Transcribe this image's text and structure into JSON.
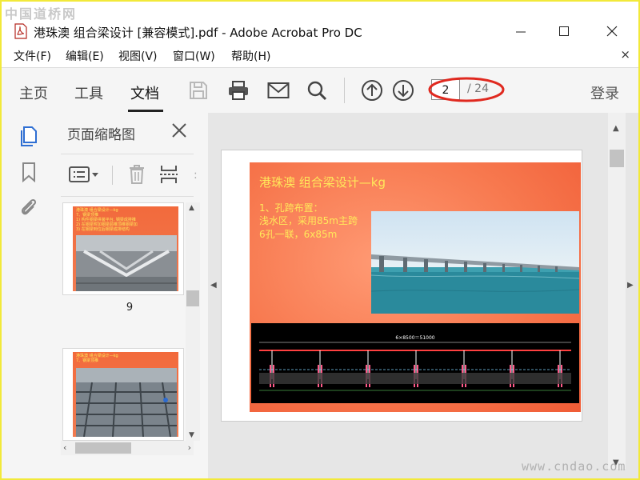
{
  "watermark_top": "中国道桥网",
  "watermark_bottom": "www.cndao.com",
  "window": {
    "title": "港珠澳 组合梁设计 [兼容模式].pdf - Adobe Acrobat Pro DC",
    "icon": "pdf-file-icon"
  },
  "menu": {
    "items": [
      "文件(F)",
      "编辑(E)",
      "视图(V)",
      "窗口(W)",
      "帮助(H)"
    ],
    "close_label": "×"
  },
  "toolbar": {
    "tabs": [
      "主页",
      "工具",
      "文档"
    ],
    "active_tab": "文档",
    "icons": [
      "save-icon",
      "print-icon",
      "email-icon",
      "search-icon",
      "page-up-icon",
      "page-down-icon"
    ],
    "page_current": "2",
    "page_total": "/ 24",
    "login_label": "登录"
  },
  "rail": {
    "icons": [
      "page-thumbnails-icon",
      "bookmark-icon",
      "attachment-icon"
    ]
  },
  "thumb_panel": {
    "title": "页面缩略图",
    "tools": [
      "options-menu-icon",
      "delete-icon",
      "insert-icon"
    ],
    "thumbnails": [
      {
        "page_label": "9",
        "text": "港珠澳 组合梁设计—kg\n7、钢梁顶推\n1) 构件钢梁拼装平台, 钢梁成排推\n2) 在钢梁附加钢梁前推顶推钢梁加\n3) 在钢梁到位后钢梁成排结构"
      },
      {
        "page_label": "",
        "text": "港珠澳 组合梁设计—kg\n7、钢梁顶推"
      }
    ]
  },
  "document": {
    "slide_title": "港珠澳 组合梁设计—kg",
    "lines": [
      "1、孔跨布置：",
      "浅水区，采用85m主跨",
      "6孔一联，6x85m"
    ],
    "drawing_dimension": "6×8500＝51000",
    "colors": {
      "slide_bg": "#f7784e",
      "slide_text": "#ffe85a",
      "accent_red": "#e0291f"
    }
  }
}
